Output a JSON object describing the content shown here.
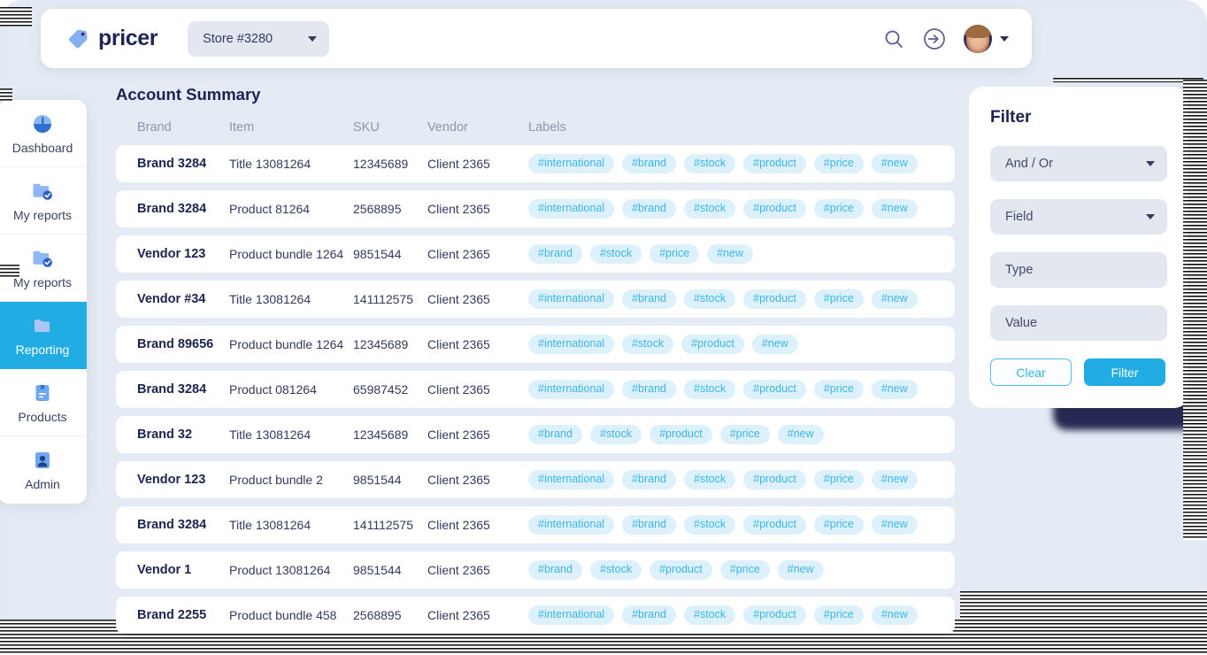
{
  "header": {
    "logo_text": "pricer",
    "logo_icon": "price-tag-icon",
    "store_selector": {
      "value": "Store #3280",
      "icon": "chevron-down-icon"
    },
    "search_icon": "search-icon",
    "login_icon": "arrow-into-circle-icon",
    "avatar_icon": "user-avatar",
    "avatar_caret_icon": "chevron-down-icon"
  },
  "sidebar": {
    "items": [
      {
        "label": "Dashboard",
        "icon": "gauge-icon",
        "active": false
      },
      {
        "label": "My reports",
        "icon": "folder-check-icon",
        "active": false
      },
      {
        "label": "My reports",
        "icon": "folder-check-icon",
        "active": false
      },
      {
        "label": "Reporting",
        "icon": "folder-icon",
        "active": true
      },
      {
        "label": "Products",
        "icon": "box-icon",
        "active": false
      },
      {
        "label": "Admin",
        "icon": "user-icon",
        "active": false
      }
    ]
  },
  "main": {
    "title": "Account Summary",
    "columns": [
      "Brand",
      "Item",
      "SKU",
      "Vendor",
      "Labels"
    ],
    "rows": [
      {
        "brand": "Brand 3284",
        "item": "Title 13081264",
        "sku": "12345689",
        "vendor": "Client 2365",
        "labels": [
          "#international",
          "#brand",
          "#stock",
          "#product",
          "#price",
          "#new"
        ]
      },
      {
        "brand": "Brand 3284",
        "item": "Product 81264",
        "sku": "2568895",
        "vendor": "Client 2365",
        "labels": [
          "#international",
          "#brand",
          "#stock",
          "#product",
          "#price",
          "#new"
        ]
      },
      {
        "brand": "Vendor 123",
        "item": "Product bundle 1264",
        "sku": "9851544",
        "vendor": "Client 2365",
        "labels": [
          "#brand",
          "#stock",
          "#price",
          "#new"
        ]
      },
      {
        "brand": "Vendor #34",
        "item": "Title 13081264",
        "sku": "141112575",
        "vendor": "Client 2365",
        "labels": [
          "#international",
          "#brand",
          "#stock",
          "#product",
          "#price",
          "#new"
        ]
      },
      {
        "brand": "Brand 89656",
        "item": "Product bundle 1264",
        "sku": "12345689",
        "vendor": "Client 2365",
        "labels": [
          "#international",
          "#stock",
          "#product",
          "#new"
        ]
      },
      {
        "brand": "Brand 3284",
        "item": "Product  081264",
        "sku": "65987452",
        "vendor": "Client 2365",
        "labels": [
          "#international",
          "#brand",
          "#stock",
          "#product",
          "#price",
          "#new"
        ]
      },
      {
        "brand": "Brand 32",
        "item": "Title 13081264",
        "sku": "12345689",
        "vendor": "Client 2365",
        "labels": [
          "#brand",
          "#stock",
          "#product",
          "#price",
          "#new"
        ]
      },
      {
        "brand": "Vendor 123",
        "item": "Product bundle 2",
        "sku": "9851544",
        "vendor": "Client 2365",
        "labels": [
          "#international",
          "#brand",
          "#stock",
          "#product",
          "#price",
          "#new"
        ]
      },
      {
        "brand": "Brand 3284",
        "item": "Title 13081264",
        "sku": "141112575",
        "vendor": "Client 2365",
        "labels": [
          "#international",
          "#brand",
          "#stock",
          "#product",
          "#price",
          "#new"
        ]
      },
      {
        "brand": "Vendor 1",
        "item": "Product  13081264",
        "sku": "9851544",
        "vendor": "Client 2365",
        "labels": [
          "#brand",
          "#stock",
          "#product",
          "#price",
          "#new"
        ]
      },
      {
        "brand": "Brand 2255",
        "item": "Product bundle 458",
        "sku": "2568895",
        "vendor": "Client 2365",
        "labels": [
          "#international",
          "#brand",
          "#stock",
          "#product",
          "#price",
          "#new"
        ]
      }
    ]
  },
  "filter_panel": {
    "title": "Filter",
    "fields": [
      {
        "label": "And / Or",
        "type": "select"
      },
      {
        "label": "Field",
        "type": "select"
      },
      {
        "label": "Type",
        "type": "text"
      },
      {
        "label": "Value",
        "type": "text"
      }
    ],
    "clear_label": "Clear",
    "filter_label": "Filter"
  },
  "colors": {
    "accent": "#22ace4",
    "navy": "#1d2350",
    "tag_bg": "#dcf1fb",
    "tag_text": "#3bb6e8",
    "page_bg": "#e5ebf4",
    "field_bg": "#e2e7f0",
    "shadow_navy": "#262a52"
  }
}
